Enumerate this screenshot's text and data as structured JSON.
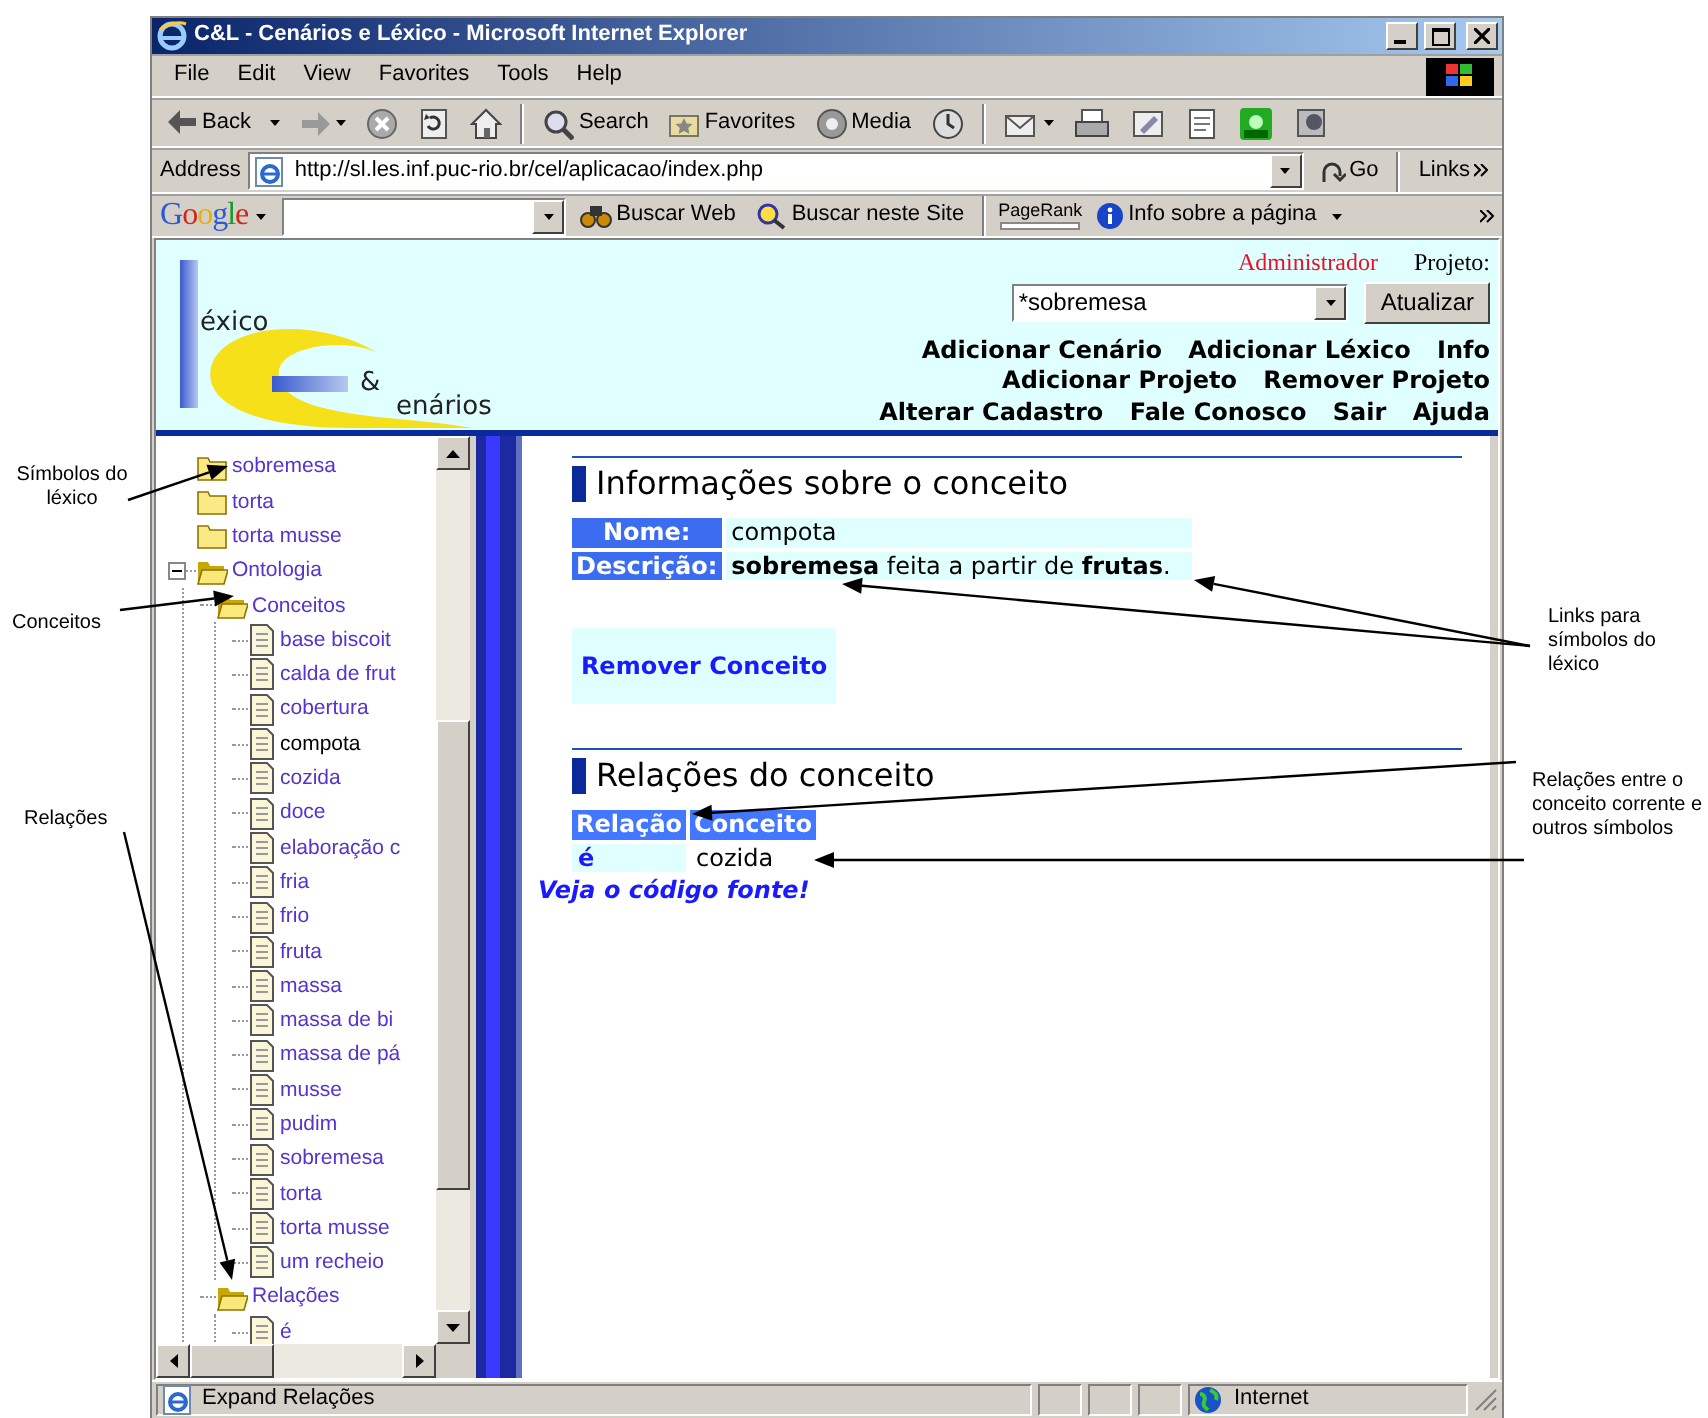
{
  "window": {
    "title": "C&L - Cenários e Léxico - Microsoft Internet Explorer"
  },
  "menu": [
    "File",
    "Edit",
    "View",
    "Favorites",
    "Tools",
    "Help"
  ],
  "toolbar": [
    {
      "label": "Back",
      "kind": "back"
    },
    {
      "label": "Search",
      "kind": "search"
    },
    {
      "label": "Favorites",
      "kind": "favorites"
    },
    {
      "label": "Media",
      "kind": "media"
    }
  ],
  "address": {
    "label": "Address",
    "url": "http://sl.les.inf.puc-rio.br/cel/aplicacao/index.php",
    "go": "Go",
    "links": "Links"
  },
  "google_bar": {
    "logo": "Google",
    "buttons": [
      "Buscar Web",
      "Buscar neste Site"
    ],
    "pagerank": "PageRank",
    "info": "Info sobre a página"
  },
  "site_header": {
    "logo": [
      "éxico",
      "&",
      "enários"
    ],
    "user": "Administrador",
    "project_label": "Projeto:",
    "project": "*sobremesa",
    "update_button": "Atualizar",
    "nav_links": [
      "Adicionar Cenário",
      "Adicionar Léxico",
      "Info",
      "Adicionar Projeto",
      "Remover Projeto",
      "Alterar Cadastro",
      "Fale Conosco",
      "Sair",
      "Ajuda"
    ]
  },
  "tree": [
    {
      "label": "sobremesa",
      "kind": "folder",
      "expanded": false,
      "selected": false
    },
    {
      "label": "torta",
      "kind": "folder",
      "expanded": false,
      "selected": false
    },
    {
      "label": "torta musse",
      "kind": "folder",
      "expanded": false,
      "selected": false
    },
    {
      "label": "Ontologia",
      "kind": "folder",
      "expanded": true,
      "selected": false,
      "children": [
        {
          "label": "Conceitos",
          "kind": "folder",
          "expanded": true,
          "selected": false,
          "children": [
            {
              "label": "base biscoit",
              "kind": "leaf",
              "selected": false
            },
            {
              "label": "calda de frut",
              "kind": "leaf",
              "selected": false
            },
            {
              "label": "cobertura",
              "kind": "leaf",
              "selected": false
            },
            {
              "label": "compota",
              "kind": "leaf",
              "selected": true
            },
            {
              "label": "cozida",
              "kind": "leaf",
              "selected": false
            },
            {
              "label": "doce",
              "kind": "leaf",
              "selected": false
            },
            {
              "label": "elaboração c",
              "kind": "leaf",
              "selected": false
            },
            {
              "label": "fria",
              "kind": "leaf",
              "selected": false
            },
            {
              "label": "frio",
              "kind": "leaf",
              "selected": false
            },
            {
              "label": "fruta",
              "kind": "leaf",
              "selected": false
            },
            {
              "label": "massa",
              "kind": "leaf",
              "selected": false
            },
            {
              "label": "massa de bi",
              "kind": "leaf",
              "selected": false
            },
            {
              "label": "massa de pá",
              "kind": "leaf",
              "selected": false
            },
            {
              "label": "musse",
              "kind": "leaf",
              "selected": false
            },
            {
              "label": "pudim",
              "kind": "leaf",
              "selected": false
            },
            {
              "label": "sobremesa",
              "kind": "leaf",
              "selected": false
            },
            {
              "label": "torta",
              "kind": "leaf",
              "selected": false
            },
            {
              "label": "torta musse",
              "kind": "leaf",
              "selected": false
            },
            {
              "label": "um recheio",
              "kind": "leaf",
              "selected": false
            }
          ]
        },
        {
          "label": "Relações",
          "kind": "folder",
          "expanded": true,
          "selected": false,
          "children": [
            {
              "label": "é",
              "kind": "leaf",
              "selected": false
            }
          ]
        }
      ]
    }
  ],
  "concept": {
    "heading": "Informações sobre o conceito",
    "name_label": "Nome:",
    "name": "compota",
    "description_label": "Descrição:",
    "description": [
      {
        "text": "sobremesa",
        "kind": "link"
      },
      {
        "text": " feita a partir de ",
        "kind": "text"
      },
      {
        "text": "frutas",
        "kind": "link"
      },
      {
        "text": ".",
        "kind": "text"
      }
    ],
    "remove": "Remover Conceito"
  },
  "relations": {
    "heading": "Relações do conceito",
    "columns": [
      "Relação",
      "Conceito"
    ],
    "rows": [
      {
        "relation": "é",
        "concept": "cozida"
      }
    ]
  },
  "source_link": "Veja o código fonte!",
  "status_bar": {
    "text": "Expand Relações",
    "zone": "Internet"
  },
  "annotations": [
    "Símbolos do léxico",
    "Conceitos",
    "Relações",
    "Links para símbolos do léxico",
    "Relações entre o conceito corrente e outros símbolos"
  ]
}
